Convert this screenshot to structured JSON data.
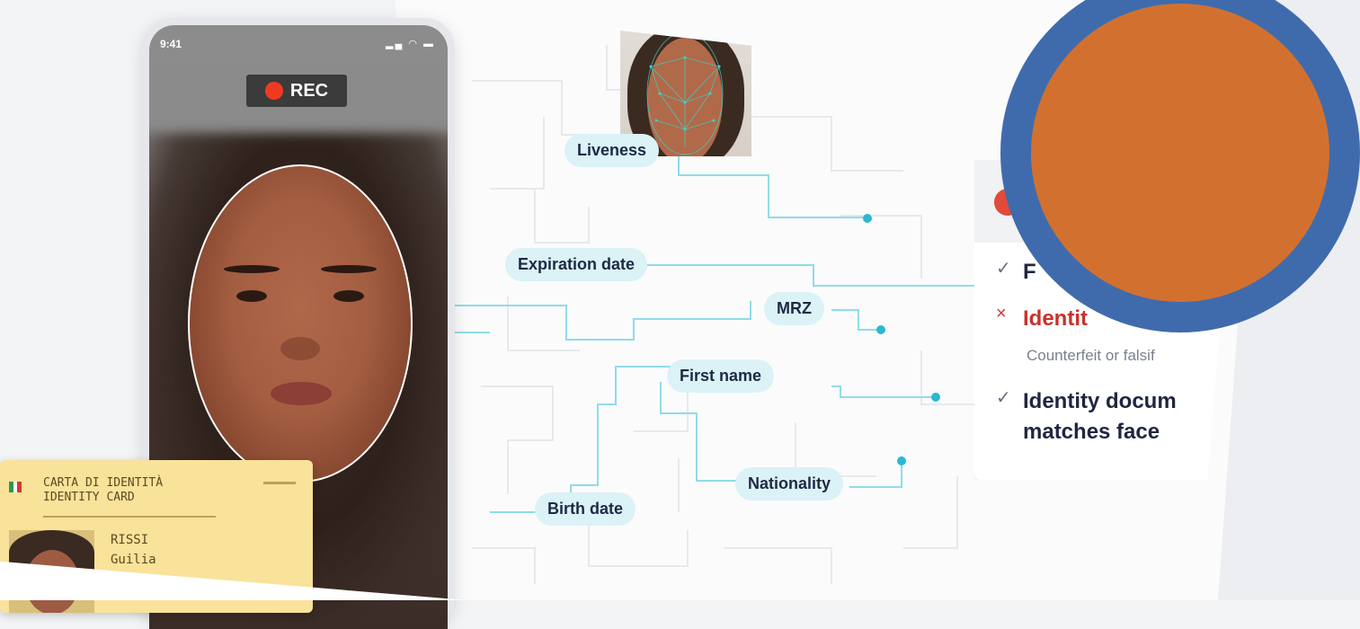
{
  "phone": {
    "time": "9:41",
    "status_icons": "▂▄ ◠ ▬",
    "rec_label": "REC"
  },
  "id_card": {
    "title_line1": "CARTA DI IDENTITÀ",
    "title_line2": "IDENTITY CARD",
    "surname": "RISSI",
    "given_name": "Guilia"
  },
  "pills": {
    "liveness": "Liveness",
    "expiration": "Expiration date",
    "mrz": "MRZ",
    "first_name": "First name",
    "nationality": "Nationality",
    "birth_date": "Birth date"
  },
  "results": {
    "item1_mark": "✓",
    "item1_text": "F",
    "item2_mark": "×",
    "item2_text": "Identit",
    "item2_sub": "Counterfeit or falsif",
    "item3_mark": "✓",
    "item3_line1": "Identity docum",
    "item3_line2": "matches face"
  },
  "colors": {
    "accent_teal": "#3fc9dc",
    "pill_bg": "#dbf2f7",
    "rec_red": "#f03a20",
    "error_red": "#c8322c",
    "circle_fill": "#d2712f",
    "circle_ring": "#3f6bad"
  }
}
